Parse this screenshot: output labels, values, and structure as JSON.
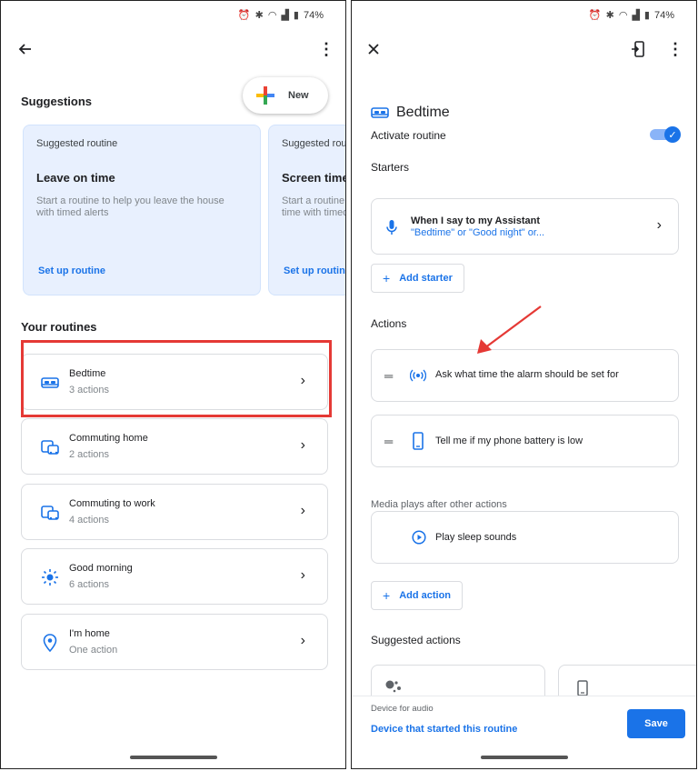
{
  "status_bar": {
    "battery": "74%"
  },
  "left": {
    "suggestions_title": "Suggestions",
    "new_label": "New",
    "suggested_cards": [
      {
        "small": "Suggested routine",
        "title": "Leave on time",
        "desc": "Start a routine to help you leave the house with timed alerts",
        "link": "Set up routine"
      },
      {
        "small": "Suggested routine",
        "title": "Screen time",
        "desc": "Start a routine to help you control screen time with timed alerts",
        "link": "Set up routine"
      }
    ],
    "your_routines_title": "Your routines",
    "routines": [
      {
        "name": "Bedtime",
        "sub": "3 actions",
        "icon": "bed-icon"
      },
      {
        "name": "Commuting home",
        "sub": "2 actions",
        "icon": "commute-icon"
      },
      {
        "name": "Commuting to work",
        "sub": "4 actions",
        "icon": "commute-icon"
      },
      {
        "name": "Good morning",
        "sub": "6 actions",
        "icon": "sun-icon"
      },
      {
        "name": "I'm home",
        "sub": "One action",
        "icon": "location-icon"
      }
    ]
  },
  "right": {
    "title": "Bedtime",
    "activate_label": "Activate routine",
    "activate_on": true,
    "starters_title": "Starters",
    "starter": {
      "title": "When I say to my Assistant",
      "sub": "\"Bedtime\" or \"Good night\" or..."
    },
    "add_starter": "Add starter",
    "actions_title": "Actions",
    "actions": [
      {
        "label": "Ask what time the alarm should be set for",
        "icon": "broadcast-icon"
      },
      {
        "label": "Tell me if my phone battery is low",
        "icon": "phone-icon"
      }
    ],
    "media_label": "Media plays after other actions",
    "media_action": "Play sleep sounds",
    "add_action": "Add action",
    "suggested_actions_title": "Suggested actions",
    "device_audio_label": "Device for audio",
    "device_audio_value": "Device that started this routine",
    "save_label": "Save"
  },
  "colors": {
    "accent": "#1a73e8",
    "highlight": "#e53935",
    "card_bg": "#e8f0fe"
  }
}
